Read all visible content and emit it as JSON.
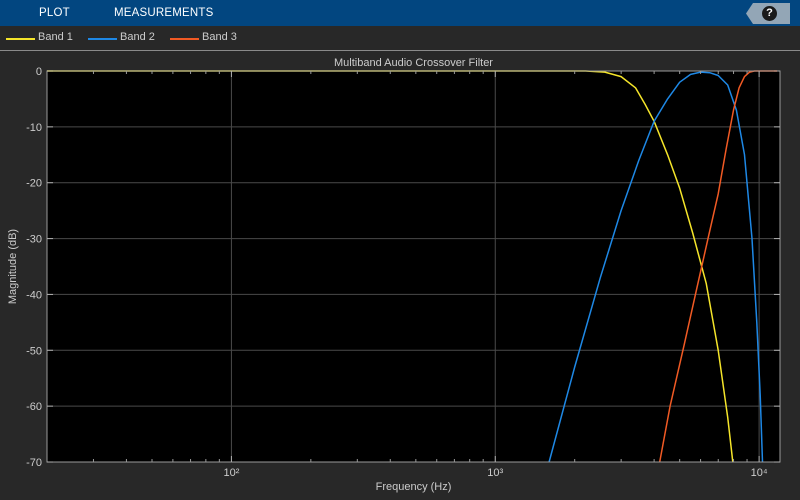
{
  "toolbar": {
    "tabs": [
      {
        "label": "PLOT"
      },
      {
        "label": "MEASUREMENTS"
      }
    ],
    "help_glyph": "?",
    "help_icon": "question-circle-icon"
  },
  "legend": {
    "items": [
      {
        "label": "Band 1",
        "color": "#f5e52a"
      },
      {
        "label": "Band 2",
        "color": "#1e88e5"
      },
      {
        "label": "Band 3",
        "color": "#f15a24"
      }
    ]
  },
  "colors": {
    "background": "#282828",
    "plot_area": "#000000",
    "toolbar": "#024680",
    "grid": "#4a4a4a",
    "text": "#cccccc"
  },
  "chart_data": {
    "type": "line",
    "title": "Multiband Audio Crossover Filter",
    "xlabel": "Frequency (Hz)",
    "ylabel": "Magnitude (dB)",
    "xscale": "log",
    "xlim": [
      20,
      12000
    ],
    "ylim": [
      -70,
      0
    ],
    "xticks": [
      {
        "value": 100,
        "label": "10²"
      },
      {
        "value": 1000,
        "label": "10³"
      },
      {
        "value": 10000,
        "label": "10⁴"
      }
    ],
    "yticks": [
      0,
      -10,
      -20,
      -30,
      -40,
      -50,
      -60,
      -70
    ],
    "grid": true,
    "legend_position": "top",
    "series": [
      {
        "name": "Band 1",
        "color": "#f5e52a",
        "points": [
          [
            20,
            0
          ],
          [
            2200,
            0
          ],
          [
            2600,
            -0.2
          ],
          [
            3000,
            -1
          ],
          [
            3400,
            -3
          ],
          [
            3700,
            -6
          ],
          [
            4000,
            -9
          ],
          [
            4500,
            -15
          ],
          [
            5000,
            -21
          ],
          [
            5600,
            -29
          ],
          [
            6300,
            -38
          ],
          [
            7000,
            -50
          ],
          [
            7600,
            -62
          ],
          [
            7950,
            -70
          ]
        ]
      },
      {
        "name": "Band 2",
        "color": "#1e88e5",
        "points": [
          [
            1600,
            -70
          ],
          [
            2000,
            -53
          ],
          [
            2500,
            -37
          ],
          [
            3000,
            -25
          ],
          [
            3500,
            -16
          ],
          [
            4000,
            -9
          ],
          [
            4500,
            -5
          ],
          [
            5000,
            -2
          ],
          [
            5500,
            -0.6
          ],
          [
            6000,
            -0.2
          ],
          [
            6500,
            -0.3
          ],
          [
            7000,
            -0.8
          ],
          [
            7600,
            -2.5
          ],
          [
            8200,
            -7
          ],
          [
            8800,
            -15
          ],
          [
            9400,
            -30
          ],
          [
            9800,
            -45
          ],
          [
            10100,
            -58
          ],
          [
            10300,
            -70
          ]
        ]
      },
      {
        "name": "Band 3",
        "color": "#f15a24",
        "points": [
          [
            4200,
            -70
          ],
          [
            4600,
            -60
          ],
          [
            5200,
            -49
          ],
          [
            5800,
            -39
          ],
          [
            6400,
            -30
          ],
          [
            7000,
            -22
          ],
          [
            7500,
            -14
          ],
          [
            8000,
            -7
          ],
          [
            8400,
            -3
          ],
          [
            8800,
            -1
          ],
          [
            9200,
            -0.2
          ],
          [
            9600,
            0
          ],
          [
            11700,
            0
          ]
        ]
      }
    ]
  }
}
